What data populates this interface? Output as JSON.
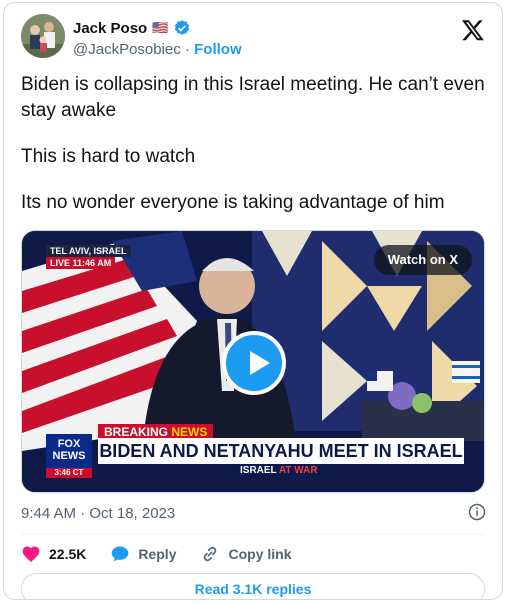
{
  "author": {
    "name": "Jack Poso",
    "flag": "🇺🇸",
    "verified_icon": "verified-badge-icon",
    "handle": "@JackPosobiec",
    "separator": " · ",
    "follow_label": "Follow"
  },
  "tweet": {
    "lines": [
      "Biden is collapsing in this Israel meeting. He can’t even stay awake",
      "This is hard to watch",
      "Its no wonder everyone is taking advantage of him"
    ]
  },
  "media": {
    "watch_label": "Watch on X",
    "location": "TEL AVIV, ISRAEL",
    "live_label": "LIVE",
    "live_time": "11:46 AM",
    "breaking_label_1": "BREAKING",
    "breaking_label_2": "NEWS",
    "headline": "BIDEN AND NETANYAHU MEET IN ISRAEL",
    "subhead_1": "ISRAEL",
    "subhead_2": "AT WAR",
    "network_1": "FOX",
    "network_2": "NEWS",
    "network_time": "3:46 CT"
  },
  "meta": {
    "timestamp": "9:44 AM · Oct 18, 2023"
  },
  "actions": {
    "likes": "22.5K",
    "reply_label": "Reply",
    "copy_label": "Copy link"
  },
  "read_replies_label": "Read 3.1K replies",
  "colors": {
    "accent": "#1d9bf0",
    "like": "#f91880",
    "muted": "#536471",
    "border": "#cfd9de"
  }
}
